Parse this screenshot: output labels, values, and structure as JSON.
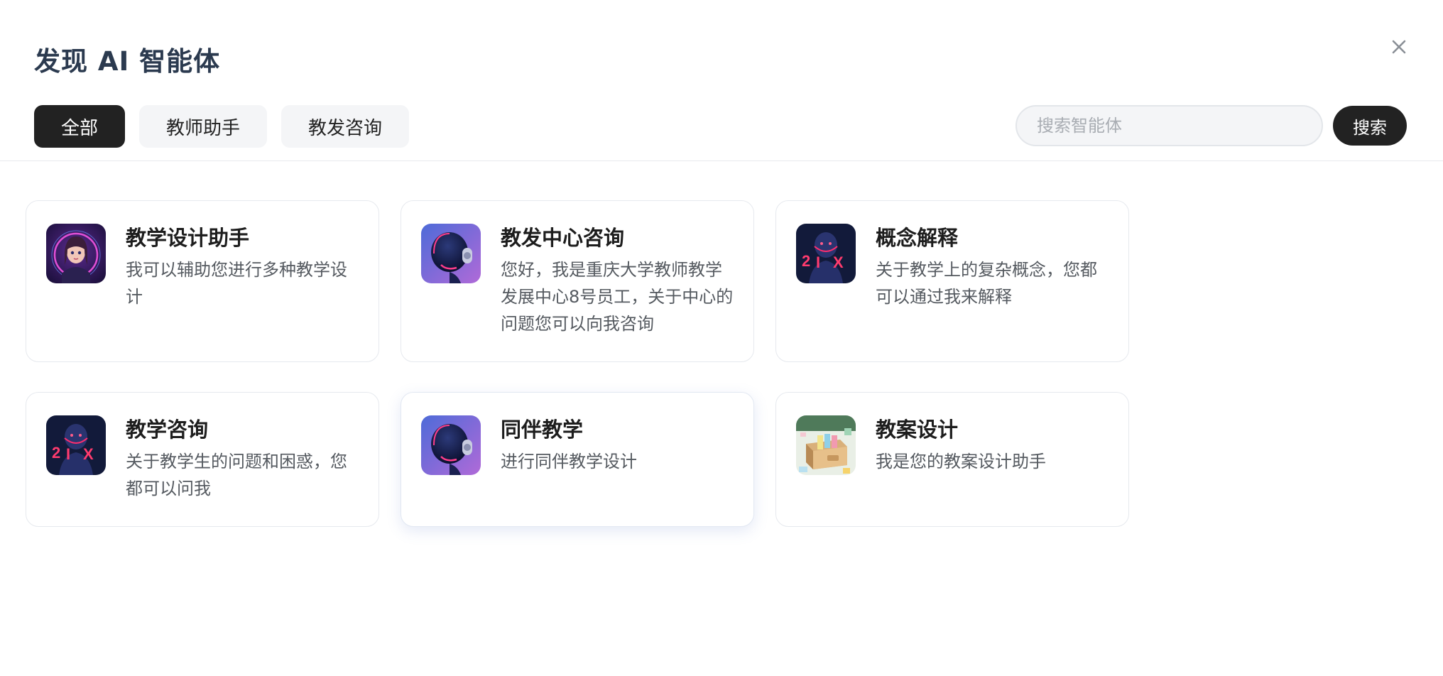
{
  "dialog": {
    "title": "发现 AI 智能体"
  },
  "tabs": [
    {
      "label": "全部",
      "active": true
    },
    {
      "label": "教师助手",
      "active": false
    },
    {
      "label": "教发咨询",
      "active": false
    }
  ],
  "search": {
    "placeholder": "搜索智能体",
    "value": "",
    "button_label": "搜索"
  },
  "agents": [
    {
      "title": "教学设计助手",
      "desc": "我可以辅助您进行多种教学设计",
      "icon": "anime-girl-avatar-icon"
    },
    {
      "title": "教发中心咨询",
      "desc": "您好，我是重庆大学教师教学发展中心8号员工，关于中心的问题您可以向我咨询",
      "icon": "robot-headphones-avatar-icon"
    },
    {
      "title": "概念解释",
      "desc": "关于教学上的复杂概念，您都可以通过我来解释",
      "icon": "neon-robot-avatar-icon"
    },
    {
      "title": "教学咨询",
      "desc": "关于教学生的问题和困惑，您都可以问我",
      "icon": "neon-robot-avatar-icon"
    },
    {
      "title": "同伴教学",
      "desc": "进行同伴教学设计",
      "icon": "robot-headphones-avatar-icon"
    },
    {
      "title": "教案设计",
      "desc": "我是您的教案设计助手",
      "icon": "file-box-avatar-icon"
    }
  ],
  "colors": {
    "title": "#2b3a4f",
    "active_tab": "#222222",
    "inactive_tab": "#f4f5f7"
  }
}
